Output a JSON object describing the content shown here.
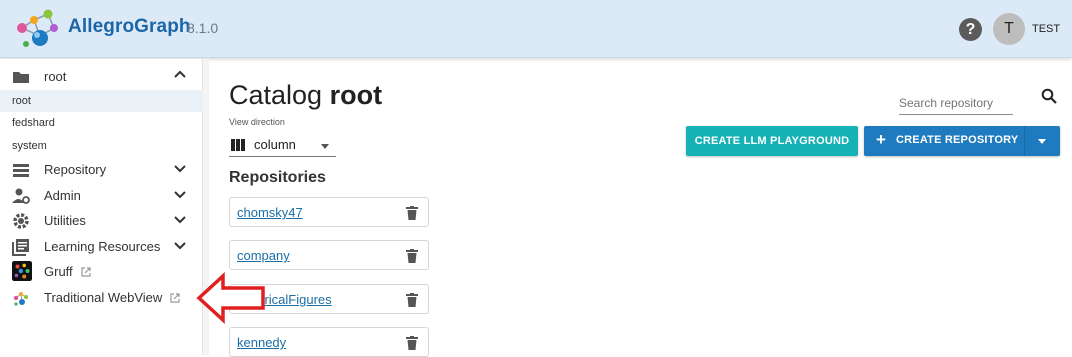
{
  "header": {
    "brand": "AllegroGraph",
    "version": "8.1.0",
    "help_symbol": "?",
    "avatar_initial": "T",
    "username": "TEST",
    "colors": {
      "bar": "#dbeaf6",
      "brand": "#1c66a8"
    }
  },
  "sidebar": {
    "catalog": {
      "label": "root",
      "icon": "folder-icon",
      "expanded": true
    },
    "catalogs": [
      {
        "label": "root",
        "active": true
      },
      {
        "label": "fedshard",
        "active": false
      },
      {
        "label": "system",
        "active": false
      }
    ],
    "items": [
      {
        "label": "Repository",
        "icon": "storage-icon",
        "expandable": true
      },
      {
        "label": "Admin",
        "icon": "admin-icon",
        "expandable": true
      },
      {
        "label": "Utilities",
        "icon": "gear-icon",
        "expandable": true
      },
      {
        "label": "Learning Resources",
        "icon": "library-icon",
        "expandable": true
      },
      {
        "label": "Gruff",
        "icon": "gruff-icon",
        "external": true
      },
      {
        "label": "Traditional WebView",
        "icon": "webview-icon",
        "external": true
      }
    ]
  },
  "main": {
    "title_prefix": "Catalog",
    "title_catalog": "root",
    "view_direction": {
      "label": "View direction",
      "value": "column",
      "icon": "columns-icon"
    },
    "repositories_heading": "Repositories",
    "repositories": [
      "chomsky47",
      "company",
      "historicalFigures",
      "kennedy"
    ],
    "search": {
      "placeholder": "Search repository",
      "value": ""
    },
    "buttons": {
      "llm_playground": "CREATE LLM PLAYGROUND",
      "create_repository": "CREATE REPOSITORY"
    },
    "colors": {
      "llm_button": "#14b1b5",
      "create_button": "#1e7bbf",
      "link": "#1c6ea4",
      "annotation_arrow": "#e02020"
    }
  }
}
